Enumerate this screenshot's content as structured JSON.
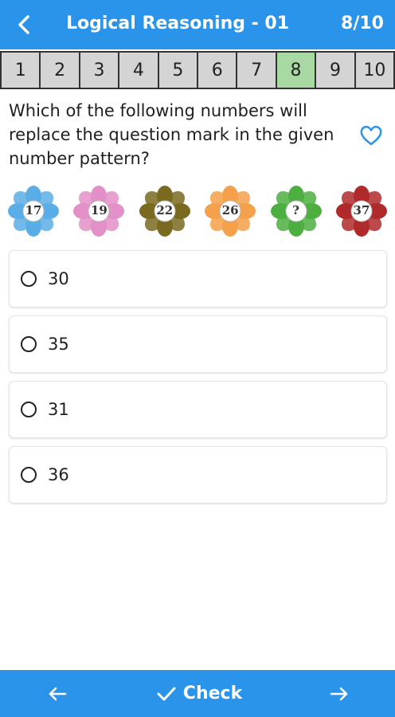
{
  "header": {
    "title": "Logical Reasoning - 01",
    "counter": "8/10"
  },
  "question_nav": [
    "1",
    "2",
    "3",
    "4",
    "5",
    "6",
    "7",
    "8",
    "9",
    "10"
  ],
  "current_question": "8",
  "question": {
    "text": "Which of the following numbers will replace the question mark in the given number pattern?"
  },
  "flowers": [
    {
      "label": "17",
      "color": "#5aaee8"
    },
    {
      "label": "19",
      "color": "#e38fc8"
    },
    {
      "label": "22",
      "color": "#7a6a1f"
    },
    {
      "label": "26",
      "color": "#f5a04a"
    },
    {
      "label": "?",
      "color": "#4caf3f"
    },
    {
      "label": "37",
      "color": "#b02a2a"
    }
  ],
  "options": [
    {
      "label": "30"
    },
    {
      "label": "35"
    },
    {
      "label": "31"
    },
    {
      "label": "36"
    }
  ],
  "footer": {
    "check_label": "Check"
  },
  "icons": {
    "back": "chevron-left-icon",
    "favorite": "heart-outline-icon",
    "prev": "arrow-left-icon",
    "next": "arrow-right-icon",
    "check": "checkmark-icon"
  },
  "colors": {
    "primary": "#2a93ea",
    "current_question": "#a9d9a2",
    "question_box": "#d4d4d4"
  }
}
